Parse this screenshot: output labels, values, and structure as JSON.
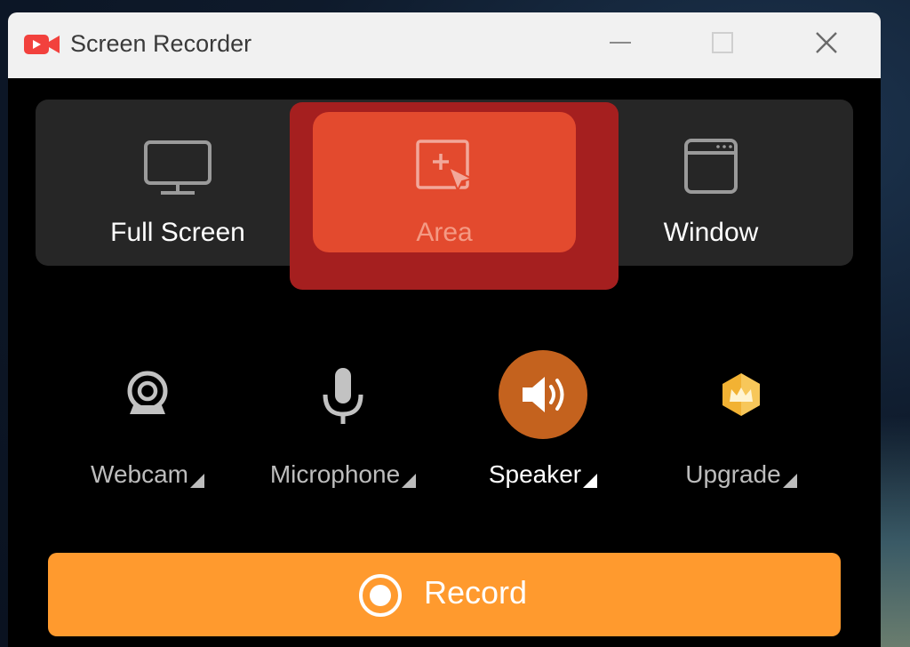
{
  "window": {
    "title": "Screen Recorder",
    "app_icon": "video-camera-icon",
    "controls": [
      "minimize-icon",
      "maximize-icon",
      "close-icon"
    ]
  },
  "modes": {
    "full_screen": {
      "label": "Full Screen",
      "icon": "monitor-icon"
    },
    "area": {
      "label": "Area",
      "icon": "area-select-icon",
      "selected": true
    },
    "window": {
      "label": "Window",
      "icon": "window-icon"
    }
  },
  "devices": {
    "webcam": {
      "label": "Webcam",
      "icon": "webcam-icon",
      "active": false
    },
    "microphone": {
      "label": "Microphone",
      "icon": "microphone-icon",
      "active": false
    },
    "speaker": {
      "label": "Speaker",
      "icon": "speaker-icon",
      "active": true
    },
    "upgrade": {
      "label": "Upgrade",
      "icon": "crown-icon",
      "active": false
    }
  },
  "record": {
    "label": "Record",
    "icon": "record-icon"
  },
  "colors": {
    "accent_orange": "#ff9a2e",
    "area_tile": "#e34a2e",
    "area_highlight": "#a51f1f",
    "speaker_circle": "#c4621e",
    "app_icon_red": "#f2413d"
  }
}
